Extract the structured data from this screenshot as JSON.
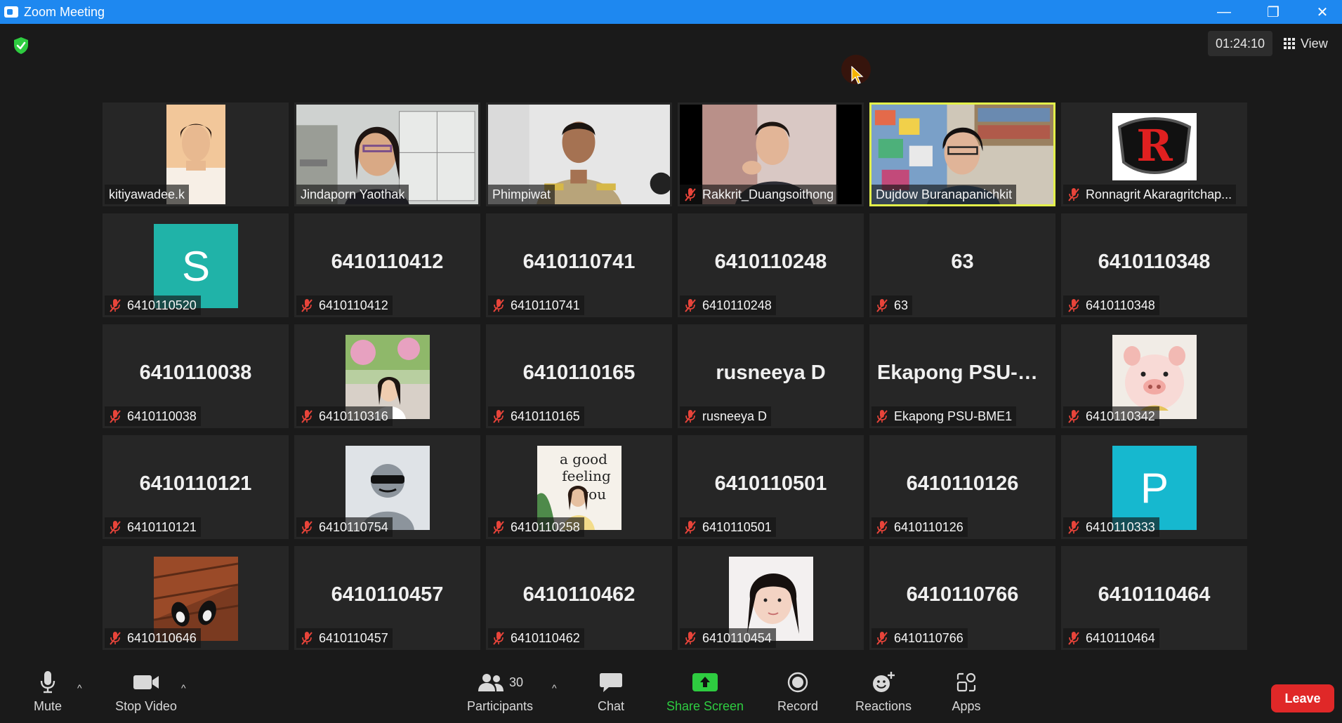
{
  "window": {
    "title": "Zoom Meeting",
    "min_glyph": "—",
    "restore_glyph": "❐",
    "close_glyph": "✕"
  },
  "header": {
    "timer": "01:24:10",
    "view_label": "View"
  },
  "tiles": [
    {
      "label": "kitiyawadee.k",
      "muted": false,
      "type": "video"
    },
    {
      "label": "Jindaporn Yaothak",
      "muted": false,
      "type": "video"
    },
    {
      "label": "Phimpiwat",
      "muted": false,
      "type": "video"
    },
    {
      "label": "Rakkrit_Duangsoithong",
      "muted": true,
      "type": "video"
    },
    {
      "label": "Dujdow Buranapanichkit",
      "muted": false,
      "type": "video",
      "active": true
    },
    {
      "label": "Ronnagrit Akaragritchap...",
      "muted": true,
      "type": "logo"
    },
    {
      "label": "6410110520",
      "muted": true,
      "type": "letter",
      "letter": "S",
      "color": "#20b3a8"
    },
    {
      "label": "6410110412",
      "muted": true,
      "type": "name",
      "bigname": "6410110412"
    },
    {
      "label": "6410110741",
      "muted": true,
      "type": "name",
      "bigname": "6410110741"
    },
    {
      "label": "6410110248",
      "muted": true,
      "type": "name",
      "bigname": "6410110248"
    },
    {
      "label": "63",
      "muted": true,
      "type": "name",
      "bigname": "63"
    },
    {
      "label": "6410110348",
      "muted": true,
      "type": "name",
      "bigname": "6410110348"
    },
    {
      "label": "6410110038",
      "muted": true,
      "type": "name",
      "bigname": "6410110038"
    },
    {
      "label": "6410110316",
      "muted": true,
      "type": "photo"
    },
    {
      "label": "6410110165",
      "muted": true,
      "type": "name",
      "bigname": "6410110165"
    },
    {
      "label": "rusneeya D",
      "muted": true,
      "type": "name",
      "bigname": "rusneeya D"
    },
    {
      "label": "Ekapong PSU-BME1",
      "muted": true,
      "type": "name",
      "bigname": "Ekapong  PSU-B..."
    },
    {
      "label": "6410110342",
      "muted": true,
      "type": "photo"
    },
    {
      "label": "6410110121",
      "muted": true,
      "type": "name",
      "bigname": "6410110121"
    },
    {
      "label": "6410110754",
      "muted": true,
      "type": "photo"
    },
    {
      "label": "6410110258",
      "muted": true,
      "type": "photo"
    },
    {
      "label": "6410110501",
      "muted": true,
      "type": "name",
      "bigname": "6410110501"
    },
    {
      "label": "6410110126",
      "muted": true,
      "type": "name",
      "bigname": "6410110126"
    },
    {
      "label": "6410110333",
      "muted": true,
      "type": "letter",
      "letter": "P",
      "color": "#16b8cf"
    },
    {
      "label": "6410110646",
      "muted": true,
      "type": "photo"
    },
    {
      "label": "6410110457",
      "muted": true,
      "type": "name",
      "bigname": "6410110457"
    },
    {
      "label": "6410110462",
      "muted": true,
      "type": "name",
      "bigname": "6410110462"
    },
    {
      "label": "6410110454",
      "muted": true,
      "type": "photo"
    },
    {
      "label": "6410110766",
      "muted": true,
      "type": "name",
      "bigname": "6410110766"
    },
    {
      "label": "6410110464",
      "muted": true,
      "type": "name",
      "bigname": "6410110464"
    }
  ],
  "toolbar": {
    "mute_label": "Mute",
    "stop_video_label": "Stop Video",
    "participants_label": "Participants",
    "participants_count": "30",
    "chat_label": "Chat",
    "share_label": "Share Screen",
    "record_label": "Record",
    "reactions_label": "Reactions",
    "apps_label": "Apps",
    "leave_label": "Leave",
    "caret_glyph": "^"
  },
  "colors": {
    "titlebar": "#1e88f0",
    "active_speaker": "#e3f04a",
    "muted_red": "#e8443a",
    "share_green": "#2ecc40",
    "leave_red": "#e02828"
  }
}
